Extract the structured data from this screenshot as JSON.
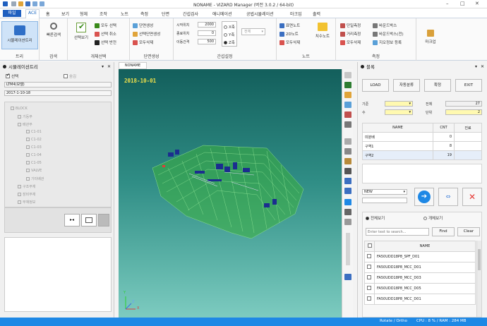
{
  "window": {
    "title": "NONAME - VIZARD Manager (버전 3.0.2 / 64-bit)",
    "minimize": "–",
    "maximize": "□",
    "close": "✕"
  },
  "ribbon": {
    "file_label": "파일",
    "tabs": [
      "ACE",
      "홈",
      "보기",
      "형체",
      "조작",
      "노트",
      "측정",
      "단면",
      "간섭검사",
      "애니메이션",
      "공법시뮬레이션",
      "마크업",
      "출력"
    ],
    "active_tab": "ACE",
    "groups": {
      "tree": {
        "button": "시뮬레이션트리",
        "label": "트리"
      },
      "search": {
        "button": "빠른검색",
        "label": "검색"
      },
      "select": {
        "big": "선택보기",
        "items": [
          "모두 선택",
          "선택 취소",
          "선택 반전"
        ],
        "label": "개체선택"
      },
      "section": {
        "items": [
          "단면생성",
          "선택단면생성",
          "모두삭제"
        ],
        "label": "단면생성"
      },
      "clash": {
        "fields": [
          {
            "label": "시작위치",
            "value": "2000"
          },
          {
            "label": "종료위치",
            "value": "0"
          },
          {
            "label": "이동간격",
            "value": "500"
          }
        ],
        "options": [
          "X축",
          "Y축",
          "Z축"
        ],
        "selected_option": "Z축",
        "combo": "전체",
        "label": "간섭설정"
      },
      "note": {
        "items": [
          "표면노트",
          "2D노트",
          "모두삭제"
        ],
        "big": "치수노트",
        "label": "노트"
      },
      "measure": {
        "items": [
          "단일측정",
          "거리측정",
          "모두삭제",
          "바운드박스",
          "바운드박스(전)",
          "지오정보 등록"
        ],
        "label": "측정"
      },
      "markup": {
        "button": "마크업",
        "label": ""
      }
    }
  },
  "left_panel": {
    "title": "시뮬레이션트리",
    "pin": "📌",
    "close": "✕",
    "options": {
      "select": "선택",
      "hide": "숨김"
    },
    "path1": "LTM4(모델)",
    "path2": "2017-1-10-18",
    "tree": [
      {
        "label": "BLOCK",
        "level": 0
      },
      {
        "label": "기둥부",
        "level": 1
      },
      {
        "label": "배관부",
        "level": 1
      },
      {
        "label": "C1-01",
        "level": 2
      },
      {
        "label": "C1-02",
        "level": 2
      },
      {
        "label": "C1-03",
        "level": 2
      },
      {
        "label": "C1-04",
        "level": 2
      },
      {
        "label": "C1-05",
        "level": 2
      },
      {
        "label": "VALVE",
        "level": 2
      },
      {
        "label": "기타배관",
        "level": 2
      },
      {
        "label": "구조부재",
        "level": 1
      },
      {
        "label": "장비부재",
        "level": 1
      },
      {
        "label": "부재정보",
        "level": 1
      }
    ]
  },
  "viewport": {
    "tab_label": "NONAME",
    "date_overlay": "2018-10-01",
    "axis": {
      "x": "X",
      "y": "Y",
      "z": "Z"
    }
  },
  "right_panel": {
    "title": "블록",
    "pin": "📌",
    "close": "✕",
    "buttons": [
      "LOAD",
      "자동분류",
      "확정",
      "EXIT"
    ],
    "form": {
      "label_gi": "기준",
      "label_su": "수",
      "label_total": "전체",
      "total_value": "27",
      "label_unit": "단위",
      "unit_value": "2"
    },
    "table": {
      "headers": [
        "NAME",
        "CNT",
        "진료"
      ],
      "rows": [
        {
          "name": "미분배",
          "cnt": "0"
        },
        {
          "name": "구역1",
          "cnt": "8"
        },
        {
          "name": "구역2",
          "cnt": "19"
        }
      ]
    },
    "new_label": "NEW",
    "radio": {
      "all": "전체보기",
      "partial": "개체보기",
      "selected": "all"
    },
    "search_placeholder": "Enter text to search...",
    "find": "Find",
    "clear": "Clear",
    "list_header": "NAME",
    "list": [
      "FA50UDD18P8_SPF_D01",
      "FA50UDD18P8_MCC_D01",
      "FA50UDD18P8_MCC_D03",
      "FA50UDD18P8_MCC_D05",
      "FA50UDD18P8_MCC_D01"
    ]
  },
  "statusbar": {
    "text": "Rotate / Ortho",
    "cpu": "CPU : 8 % / RAM : 284 MB"
  },
  "colors": {
    "accent": "#1f5fbf",
    "status_bar": "#1e88e5",
    "view_top": "#135f5c",
    "view_bottom": "#7dcbc0",
    "model_green": "#3db03d",
    "next_button": "#1e88e5",
    "delete_button": "#e53935"
  }
}
